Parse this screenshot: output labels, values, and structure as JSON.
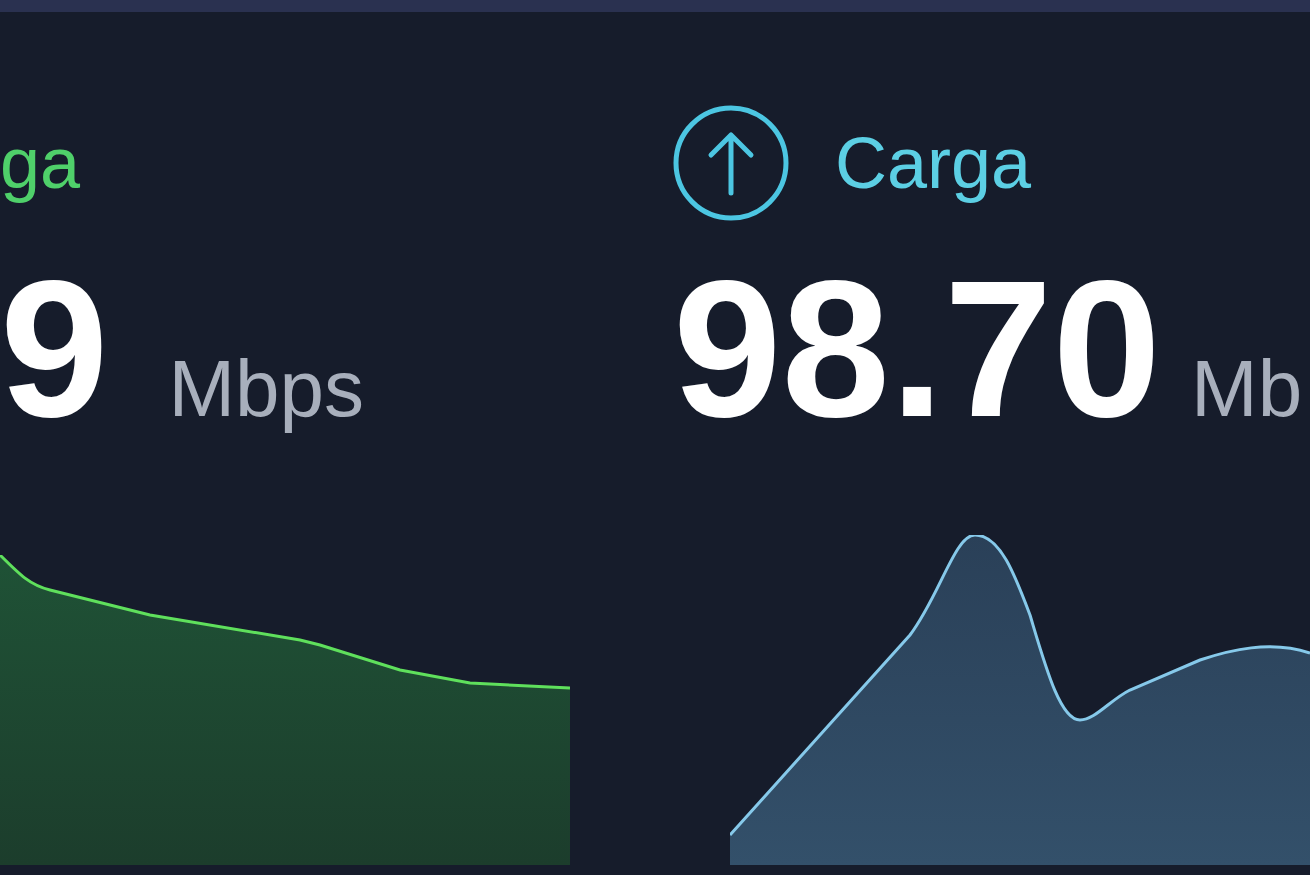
{
  "download": {
    "label": "ga",
    "value": "9",
    "unit": "Mbps"
  },
  "upload": {
    "label": "Carga",
    "value": "98.70",
    "unit": "Mb"
  }
}
